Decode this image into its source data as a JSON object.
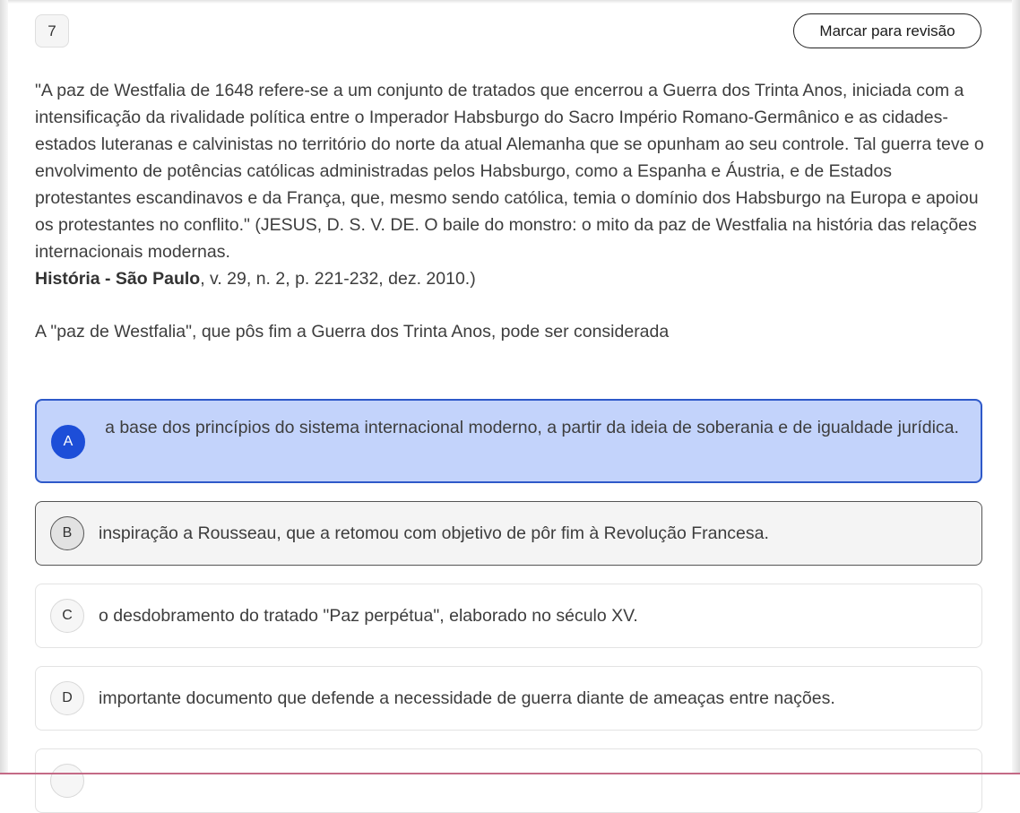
{
  "question": {
    "number": "7",
    "review_label": "Marcar para revisão",
    "stem_text": "\"A paz de Westfalia de 1648 refere-se a um conjunto de tratados que encerrou a Guerra dos Trinta Anos, iniciada com a intensificação da rivalidade política entre o Imperador Habsburgo do Sacro Império Romano-Germânico e as cidades-estados luteranas e calvinistas no território do norte da atual Alemanha que se opunham ao seu controle. Tal guerra teve o envolvimento de potências católicas administradas pelos Habsburgo, como a Espanha e Áustria, e de Estados protestantes escandinavos e da França, que, mesmo sendo católica, temia o domínio dos Habsburgo na Europa e apoiou os protestantes no conflito.\" (JESUS, D. S. V. DE. O baile do monstro: o mito da paz de Westfalia na história das relações internacionais modernas.",
    "source_bold": "História - São Paulo",
    "source_rest": ", v. 29, n. 2, p. 221-232, dez. 2010.)",
    "prompt": "A \"paz de Westfalia\", que pôs fim a Guerra dos Trinta Anos, pode ser considerada"
  },
  "options": [
    {
      "letter": "A",
      "text": "a base dos princípios do sistema internacional moderno, a partir da ideia de soberania e de igualdade jurídica.",
      "state": "selected"
    },
    {
      "letter": "B",
      "text": "inspiração a Rousseau, que a retomou com objetivo de pôr fim à Revolução Francesa.",
      "state": "hover"
    },
    {
      "letter": "C",
      "text": "o desdobramento do tratado \"Paz perpétua\", elaborado no século XV.",
      "state": "default"
    },
    {
      "letter": "D",
      "text": "importante documento que defende a necessidade de guerra diante de ameaças entre nações.",
      "state": "default"
    }
  ],
  "colors": {
    "selected_bg": "#c3d3fb",
    "selected_border": "#2e59c9",
    "selected_badge": "#1d4ed8"
  }
}
